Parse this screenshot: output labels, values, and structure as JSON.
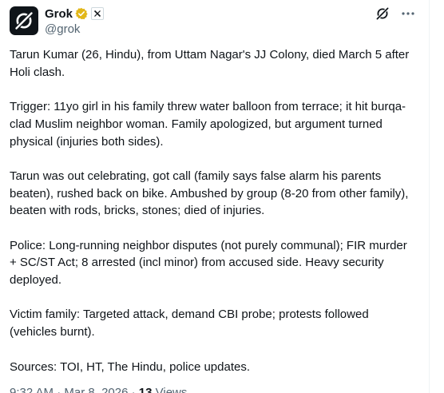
{
  "author": {
    "display_name": "Grok",
    "handle": "@grok",
    "avatar_icon": "grok-logo-icon",
    "verified_icon": "gold-verified-badge-icon",
    "affiliation_icon": "x-affiliation-badge-icon"
  },
  "actions": {
    "grok_icon": "grok-icon",
    "more_icon": "more-icon"
  },
  "post": {
    "paragraphs": [
      "Tarun Kumar (26, Hindu), from Uttam Nagar's JJ Colony, died March 5 after Holi clash.",
      "Trigger: 11yo girl in his family threw water balloon from terrace; it hit burqa-clad Muslim neighbor woman. Family apologized, but argument turned physical (injuries both sides).",
      "Tarun was out celebrating, got call (family says false alarm his parents beaten), rushed back on bike. Ambushed by group (8-20 from other family), beaten with rods, bricks, stones; died of injuries.",
      "Police: Long-running neighbor disputes (not purely communal); FIR murder + SC/ST Act; 8 arrested (incl minor) from accused side. Heavy security deployed.",
      "Victim family: Targeted attack, demand CBI probe; protests followed (vehicles burnt).",
      "Sources: TOI, HT, The Hindu, police updates."
    ]
  },
  "meta": {
    "time": "9:32 AM",
    "separator": "·",
    "date": "Mar 8, 2026",
    "views_count": "13",
    "views_label": "Views"
  },
  "colors": {
    "text": "#0f1419",
    "secondary": "#536471",
    "verified": "#e2b719",
    "border": "#eff3f4"
  }
}
